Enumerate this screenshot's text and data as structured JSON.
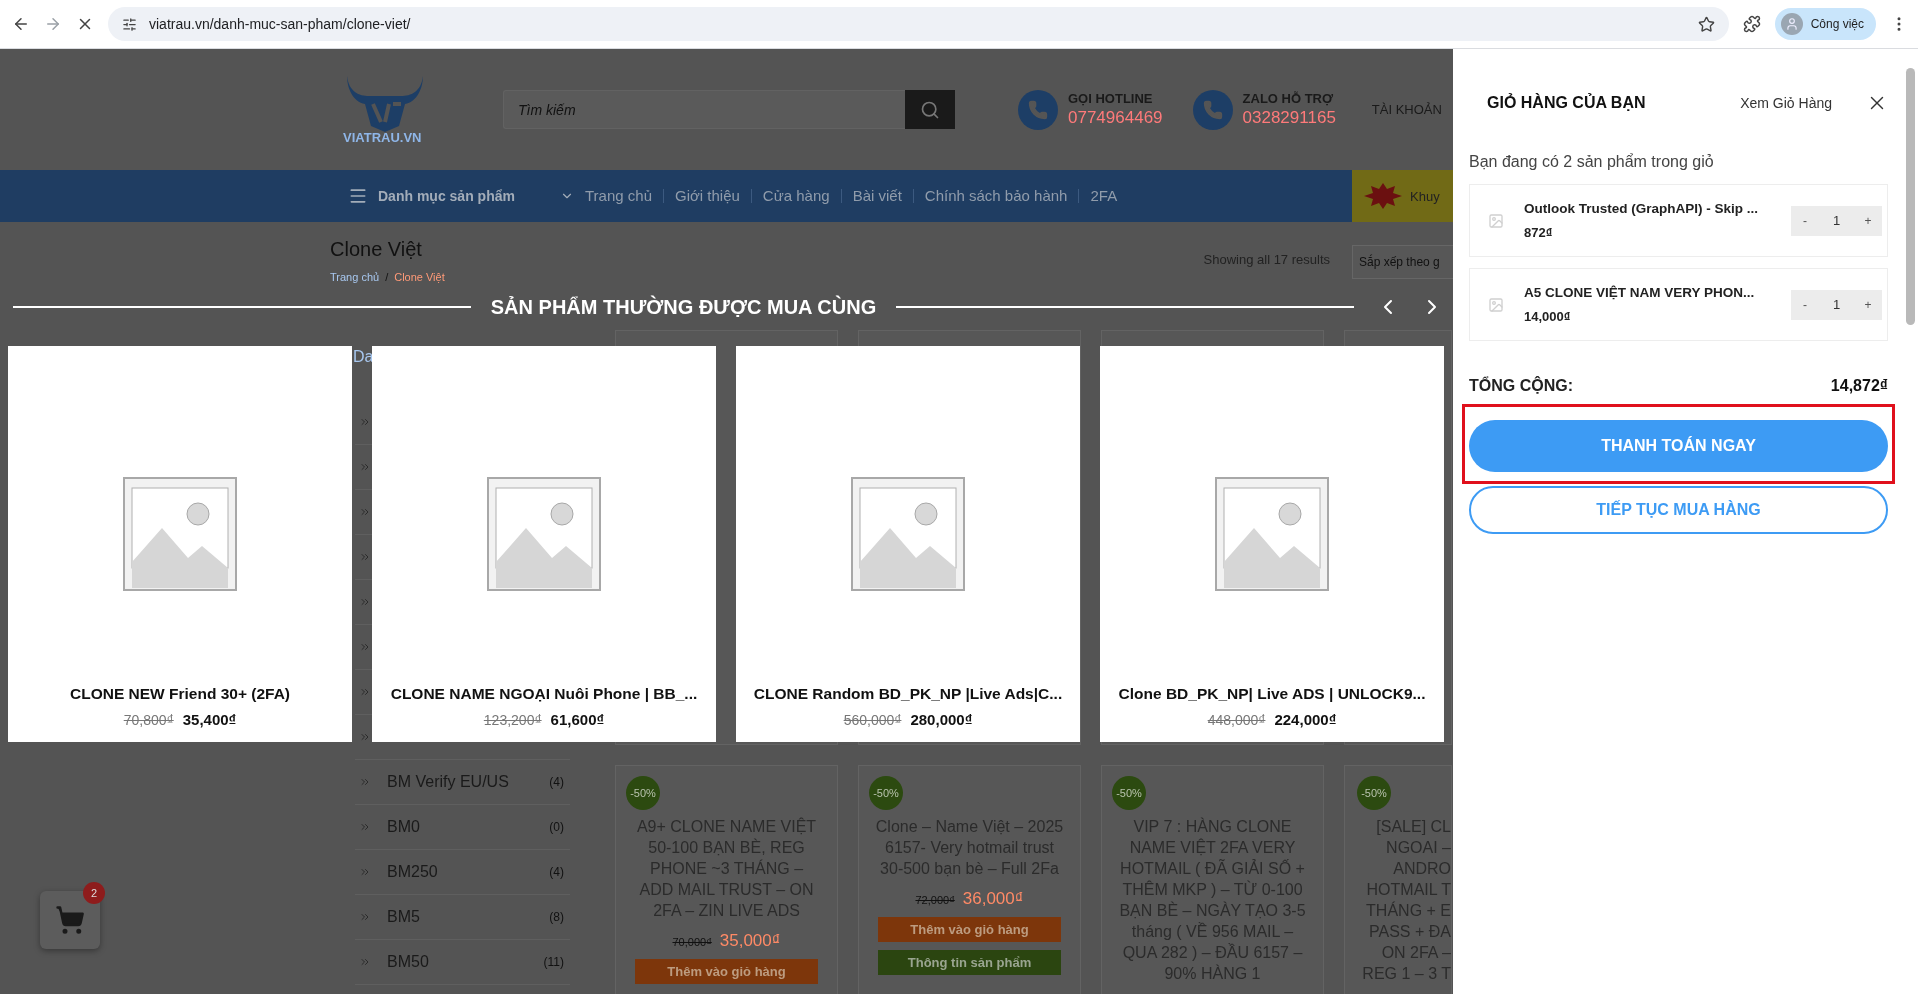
{
  "browser": {
    "url": "viatrau.vn/danh-muc-san-pham/clone-viet/",
    "profile": "Công việc"
  },
  "header": {
    "logo_text": "VIATRAU.VN",
    "search_placeholder": "Tìm kiếm",
    "contacts": [
      {
        "label": "GỌI HOTLINE",
        "number": "0774964469"
      },
      {
        "label": "ZALO HỖ TRỢ",
        "number": "0328291165"
      }
    ],
    "account": "TÀI KHOẢN"
  },
  "nav": {
    "category_menu": "Danh mục sản phẩm",
    "items": [
      "Trang chủ",
      "Giới thiệu",
      "Cửa hàng",
      "Bài viết",
      "Chính sách bảo hành",
      "2FA"
    ],
    "promo": "Khuy"
  },
  "page": {
    "title": "Clone Việt",
    "breadcrumb": [
      "Trang chủ",
      "Clone Việt"
    ],
    "breadcrumb_separator": "/",
    "result_count": "Showing all 17 results",
    "sort": "Sắp xếp theo g"
  },
  "sidebar": {
    "heading": "Da",
    "categories": [
      {
        "name": "BM Verify EU/US",
        "count": "(4)"
      },
      {
        "name": "BM0",
        "count": "(0)"
      },
      {
        "name": "BM250",
        "count": "(4)"
      },
      {
        "name": "BM5",
        "count": "(8)"
      },
      {
        "name": "BM50",
        "count": "(11)"
      }
    ]
  },
  "products": [
    {
      "kind": "full",
      "badge": "-50%",
      "name": "A9+ CLONE NAME VIỆT 50-100 BẠN BÈ, REG PHONE ~3 THÁNG – ADD MAIL TRUST – ON 2FA – ZIN LIVE ADS",
      "old_price": "70,000₫",
      "price": "35,000₫",
      "buttons": [
        "Thêm vào giỏ hàng"
      ]
    },
    {
      "kind": "full",
      "badge": "-50%",
      "name": "Clone – Name Việt – 2025 6157- Very hotmail trust 30-500 bạn bè – Full 2Fa",
      "old_price": "72,000₫",
      "price": "36,000₫",
      "buttons": [
        "Thêm vào giỏ hàng",
        "Thông tin sản phẩm"
      ]
    },
    {
      "kind": "full",
      "badge": "-50%",
      "name": "VIP 7 : HÀNG CLONE NAME VIỆT 2FA VERY HOTMAIL ( ĐÃ GIẢI SỐ + THÊM MKP ) – TỪ 0-100 BẠN BÈ – NGÀY TẠO 3-5 tháng ( VỀ 956 MAIL – QUA 282 ) – ĐẦU 6157 – 90% HÀNG 1"
    },
    {
      "kind": "cut",
      "badge": "-50%",
      "name": "[SALE] CL\nNGOAI –\nANDRO\nHOTMAIL T\nTHÁNG + E\nPASS + ĐA\nON 2FA –\nREG 1 – 3 T"
    }
  ],
  "related": {
    "title": "SẢN PHẨM THƯỜNG ĐƯỢC MUA CÙNG",
    "items": [
      {
        "name": "CLONE NEW Friend 30+ (2FA)",
        "old_price": "70,800₫",
        "price": "35,400₫"
      },
      {
        "name": "CLONE NAME NGOẠI Nuôi Phone | BB_...",
        "old_price": "123,200₫",
        "price": "61,600₫"
      },
      {
        "name": "CLONE Random BD_PK_NP |Live Ads|C...",
        "old_price": "560,000₫",
        "price": "280,000₫"
      },
      {
        "name": "Clone BD_PK_NP| Live ADS | UNLOCK9...",
        "old_price": "448,000₫",
        "price": "224,000₫"
      }
    ]
  },
  "floating_cart": {
    "count": "2"
  },
  "cart": {
    "title": "GIỎ HÀNG CỦA BẠN",
    "view_link": "Xem Giỏ Hàng",
    "summary": "Bạn đang có 2 sản phẩm trong giỏ",
    "items": [
      {
        "name": "Outlook Trusted (GraphAPI) - Skip ...",
        "price": "872₫",
        "quantity": "1",
        "decrement": "-",
        "increment": "+"
      },
      {
        "name": "A5 CLONE VIỆT NAM VERY PHON...",
        "price": "14,000₫",
        "quantity": "1",
        "decrement": "-",
        "increment": "+"
      }
    ],
    "total_label": "TỔNG CỘNG:",
    "total": "14,872₫",
    "checkout": "THANH TOÁN NGAY",
    "checkout_highlighted": true,
    "continue": "TIẾP TỤC MUA HÀNG"
  }
}
